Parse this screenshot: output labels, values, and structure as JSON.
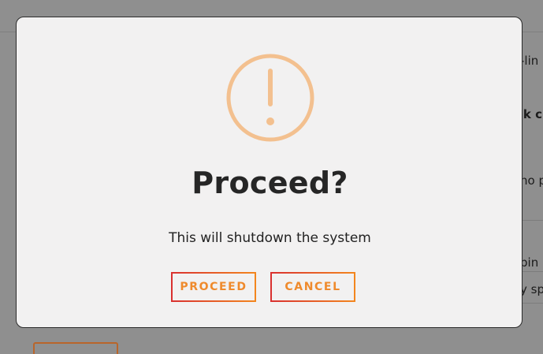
{
  "background_page": {
    "fragments": [
      {
        "text": "-lin"
      },
      {
        "text": "ck c"
      },
      {
        "text": "no p"
      },
      {
        "text": "pin"
      },
      {
        "text": "y sp"
      }
    ]
  },
  "dialog": {
    "icon": "warning-exclamation-circle-icon",
    "icon_color": "#f3c08f",
    "title": "Proceed?",
    "message": "This will shutdown the system",
    "buttons": {
      "proceed_label": "PROCEED",
      "cancel_label": "CANCEL"
    },
    "accent_gradient": [
      "#d9302f",
      "#f3861e"
    ]
  }
}
